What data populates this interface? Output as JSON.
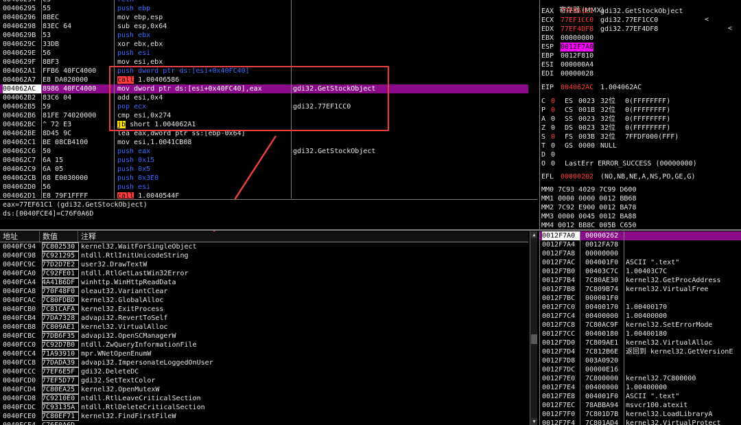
{
  "disasm": {
    "rows": [
      {
        "addr": "00406294",
        "hex": "C3",
        "instr": "retn",
        "style": "dim"
      },
      {
        "addr": "00406295",
        "hex": "55",
        "instr": "push ebp",
        "style": "push"
      },
      {
        "addr": "00406296",
        "hex": "8BEC",
        "instr": "mov ebp,esp",
        "style": "normal"
      },
      {
        "addr": "00406298",
        "hex": "83EC 64",
        "instr": "sub esp,0x64",
        "style": "normal"
      },
      {
        "addr": "0040629B",
        "hex": "53",
        "instr": "push ebx",
        "style": "push"
      },
      {
        "addr": "0040629C",
        "hex": "33DB",
        "instr": "xor ebx,ebx",
        "style": "normal"
      },
      {
        "addr": "0040629E",
        "hex": "56",
        "instr": "push esi",
        "style": "push"
      },
      {
        "addr": "0040629F",
        "hex": "8BF3",
        "instr": "mov esi,ebx",
        "style": "normal"
      },
      {
        "addr": "004062A1",
        "hex": "FFB6 40FC4000",
        "instr": "push dword ptr ds:[esi+0x40FC40]",
        "style": "push"
      },
      {
        "addr": "004062A7",
        "hex": "E8 DA020000",
        "instr": "call 1.00406586",
        "style": "call"
      },
      {
        "addr": "004062AC",
        "hex": "8986 40FC4000",
        "instr": "mov dword ptr ds:[esi+0x40FC40],eax",
        "style": "sel",
        "comment": "gdi32.GetStockObject"
      },
      {
        "addr": "004062B2",
        "hex": "83C6 04",
        "instr": "add esi,0x4",
        "style": "normal"
      },
      {
        "addr": "004062B5",
        "hex": "59",
        "instr": "pop ecx",
        "style": "push",
        "comment": "gdi32.77EF1CC0"
      },
      {
        "addr": "004062B6",
        "hex": "81FE 74020000",
        "instr": "cmp esi,0x274",
        "style": "normal"
      },
      {
        "addr": "004062BC",
        "hex": "^ 72 E3",
        "instr": "jb short 1.004062A1",
        "style": "jump"
      },
      {
        "addr": "004062BE",
        "hex": "8D45 9C",
        "instr": "lea eax,dword ptr ss:[ebp-0x64]",
        "style": "normal"
      },
      {
        "addr": "004062C1",
        "hex": "BE 08CB4100",
        "instr": "mov esi,1.0041CB08",
        "style": "normal"
      },
      {
        "addr": "004062C6",
        "hex": "50",
        "instr": "push eax",
        "style": "push",
        "comment": "gdi32.GetStockObject"
      },
      {
        "addr": "004062C7",
        "hex": "6A 15",
        "instr": "push 0x15",
        "style": "push"
      },
      {
        "addr": "004062C9",
        "hex": "6A 05",
        "instr": "push 0x5",
        "style": "push"
      },
      {
        "addr": "004062CB",
        "hex": "68 E0030000",
        "instr": "push 0x3E0",
        "style": "push"
      },
      {
        "addr": "004062D0",
        "hex": "56",
        "instr": "push esi",
        "style": "push"
      },
      {
        "addr": "004062D1",
        "hex": "E8 79F1FFFF",
        "instr": "call 1.0040544F",
        "style": "call"
      }
    ],
    "info_lines": [
      "eax=77EF61C1 (gdi32.GetStockObject)",
      "ds:[0040FCE4]=C76F0A6D"
    ]
  },
  "registers": {
    "title": "寄存器 (MMX)",
    "nav": [
      "<",
      "<"
    ],
    "gp": [
      {
        "name": "EAX",
        "value": "77EF61C1",
        "comment": "gdi32.GetStockObject",
        "changed": true
      },
      {
        "name": "ECX",
        "value": "77EF1CC0",
        "comment": "gdi32.77EF1CC0",
        "changed": true
      },
      {
        "name": "EDX",
        "value": "77EF4DF8",
        "comment": "gdi32.77EF4DF8",
        "changed": true
      },
      {
        "name": "EBX",
        "value": "00000000",
        "comment": "",
        "changed": false
      },
      {
        "name": "ESP",
        "value": "0012F7A0",
        "comment": "",
        "changed": false,
        "boxed": true
      },
      {
        "name": "EBP",
        "value": "0012F810",
        "comment": "",
        "changed": false
      },
      {
        "name": "ESI",
        "value": "000000A4",
        "comment": "",
        "changed": false
      },
      {
        "name": "EDI",
        "value": "00000028",
        "comment": "",
        "changed": false
      }
    ],
    "eip": {
      "name": "EIP",
      "value": "004062AC",
      "comment": "1.004062AC"
    },
    "flags": [
      {
        "f": "C",
        "v": "0",
        "seg": "ES",
        "sel": "0023",
        "bits": "32位",
        "base": "0(FFFFFFFF)",
        "red": true
      },
      {
        "f": "P",
        "v": "0",
        "seg": "CS",
        "sel": "001B",
        "bits": "32位",
        "base": "0(FFFFFFFF)",
        "red": true
      },
      {
        "f": "A",
        "v": "0",
        "seg": "SS",
        "sel": "0023",
        "bits": "32位",
        "base": "0(FFFFFFFF)",
        "red": false
      },
      {
        "f": "Z",
        "v": "0",
        "seg": "DS",
        "sel": "0023",
        "bits": "32位",
        "base": "0(FFFFFFFF)",
        "red": false
      },
      {
        "f": "S",
        "v": "0",
        "seg": "FS",
        "sel": "003B",
        "bits": "32位",
        "base": "7FFDF000(FFF)",
        "red": true
      },
      {
        "f": "T",
        "v": "0",
        "seg": "GS",
        "sel": "0000",
        "bits": "NULL",
        "base": "",
        "red": false
      },
      {
        "f": "D",
        "v": "0",
        "seg": "",
        "sel": "",
        "bits": "",
        "base": "",
        "red": false
      },
      {
        "f": "O",
        "v": "0",
        "seg": "",
        "sel": "",
        "bits": "",
        "base": "LastErr ERROR_SUCCESS (00000000)",
        "red": false
      }
    ],
    "efl": {
      "name": "EFL",
      "value": "00000202",
      "comment": "(NO,NB,NE,A,NS,PO,GE,G)"
    },
    "mmx": [
      "MM0 7C93 4029 7C99 D600",
      "MM1 0000 0000 0012 BB68",
      "MM2 7C92 E900 0012 BA78",
      "MM3 0000 0045 0012 BA88",
      "MM4 0012 BB8C 005B C650"
    ]
  },
  "dump": {
    "headers": [
      "地址",
      "数值",
      "注释"
    ],
    "rows": [
      {
        "addr": "0040FC94",
        "val": "7C802530",
        "cmt": "kernel32.WaitForSingleObject"
      },
      {
        "addr": "0040FC98",
        "val": "7C921295",
        "cmt": "ntdll.RtlInitUnicodeString"
      },
      {
        "addr": "0040FC9C",
        "val": "77D2D7E2",
        "cmt": "user32.DrawTextW"
      },
      {
        "addr": "0040FCA0",
        "val": "7C92FE01",
        "cmt": "ntdll.RtlGetLastWin32Error"
      },
      {
        "addr": "0040FCA4",
        "val": "4A41B6DF",
        "cmt": "winhttp.WinHttpReadData"
      },
      {
        "addr": "0040FCA8",
        "val": "770F48F0",
        "cmt": "oleaut32.VariantClear"
      },
      {
        "addr": "0040FCAC",
        "val": "7C80FDBD",
        "cmt": "kernel32.GlobalAlloc"
      },
      {
        "addr": "0040FCB0",
        "val": "7C81CAFA",
        "cmt": "kernel32.ExitProcess"
      },
      {
        "addr": "0040FCB4",
        "val": "77DA7328",
        "cmt": "advapi32.RevertToSelf"
      },
      {
        "addr": "0040FCB8",
        "val": "7C809AE1",
        "cmt": "kernel32.VirtualAlloc"
      },
      {
        "addr": "0040FCBC",
        "val": "77DB6F35",
        "cmt": "advapi32.OpenSCManagerW"
      },
      {
        "addr": "0040FCC0",
        "val": "7C92D7B0",
        "cmt": "ntdll.ZwQueryInformationFile"
      },
      {
        "addr": "0040FCC4",
        "val": "71A93910",
        "cmt": "mpr.WNetOpenEnumW"
      },
      {
        "addr": "0040FCC8",
        "val": "77DADA39",
        "cmt": "advapi32.ImpersonateLoggedOnUser"
      },
      {
        "addr": "0040FCCC",
        "val": "77EF6E5F",
        "cmt": "gdi32.DeleteDC"
      },
      {
        "addr": "0040FCD0",
        "val": "77EF5D77",
        "cmt": "gdi32.SetTextColor"
      },
      {
        "addr": "0040FCD4",
        "val": "7C80EA25",
        "cmt": "kernel32.OpenMutexW"
      },
      {
        "addr": "0040FCD8",
        "val": "7C9210E0",
        "cmt": "ntdll.RtlLeaveCriticalSection"
      },
      {
        "addr": "0040FCDC",
        "val": "7C93135A",
        "cmt": "ntdll.RtlDeleteCriticalSection"
      },
      {
        "addr": "0040FCE0",
        "val": "7C80EF71",
        "cmt": "kernel32.FindFirstFileW"
      },
      {
        "addr": "0040FCE4",
        "val": "C76F0A6D",
        "cmt": ""
      }
    ]
  },
  "stack": {
    "rows": [
      {
        "addr": "0012F7A0",
        "val": "00000262",
        "cmt": "",
        "sel": true
      },
      {
        "addr": "0012F7A4",
        "val": "0012FA78",
        "cmt": ""
      },
      {
        "addr": "0012F7A8",
        "val": "00000000",
        "cmt": ""
      },
      {
        "addr": "0012F7AC",
        "val": "004001F0",
        "cmt": "ASCII \".text\""
      },
      {
        "addr": "0012F7B0",
        "val": "00403C7C",
        "cmt": "1.00403C7C"
      },
      {
        "addr": "0012F7B4",
        "val": "7C80AE30",
        "cmt": "kernel32.GetProcAddress"
      },
      {
        "addr": "0012F7B8",
        "val": "7C809B74",
        "cmt": "kernel32.VirtualFree"
      },
      {
        "addr": "0012F7BC",
        "val": "000001F0",
        "cmt": ""
      },
      {
        "addr": "0012F7C0",
        "val": "00400170",
        "cmt": "1.00400170"
      },
      {
        "addr": "0012F7C4",
        "val": "00400000",
        "cmt": "1.00400000"
      },
      {
        "addr": "0012F7C8",
        "val": "7C80AC9F",
        "cmt": "kernel32.SetErrorMode"
      },
      {
        "addr": "0012F7CC",
        "val": "00400180",
        "cmt": "1.00400180"
      },
      {
        "addr": "0012F7D0",
        "val": "7C809AE1",
        "cmt": "kernel32.VirtualAlloc"
      },
      {
        "addr": "0012F7D4",
        "val": "7C812B6E",
        "cmt": "返回到 kernel32.GetVersionE"
      },
      {
        "addr": "0012F7D8",
        "val": "003A0920",
        "cmt": ""
      },
      {
        "addr": "0012F7DC",
        "val": "00000E16",
        "cmt": ""
      },
      {
        "addr": "0012F7E0",
        "val": "7C800000",
        "cmt": "kernel32.7C800000"
      },
      {
        "addr": "0012F7E4",
        "val": "00400000",
        "cmt": "1.00400000"
      },
      {
        "addr": "0012F7E8",
        "val": "004001F0",
        "cmt": "ASCII \".text\""
      },
      {
        "addr": "0012F7EC",
        "val": "78ABBA94",
        "cmt": "msvcr100.atexit"
      },
      {
        "addr": "0012F7F0",
        "val": "7C801D7B",
        "cmt": "kernel32.LoadLibraryA"
      },
      {
        "addr": "0012F7F4",
        "val": "7C801AD4",
        "cmt": "kernel32.VirtualProtect"
      }
    ]
  },
  "colors": {
    "selection": "#8a0a8a",
    "annotation": "#e84040",
    "keyword_push": "#3d6bff",
    "call_bg": "#ff3b3b",
    "jump_bg": "#ffe300"
  }
}
